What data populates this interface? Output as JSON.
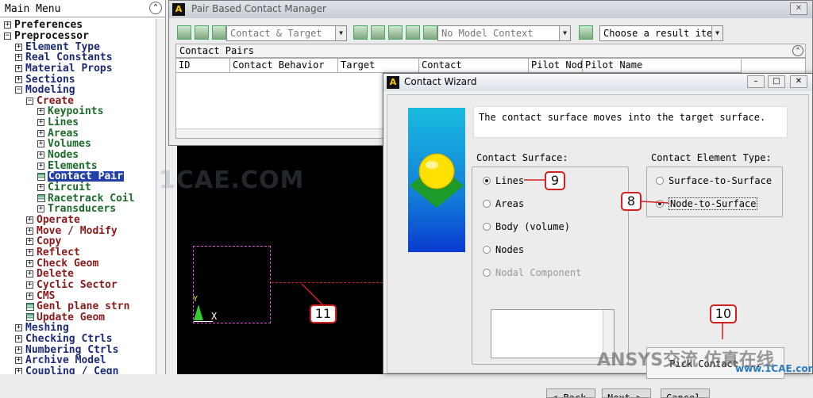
{
  "main_menu": {
    "title": "Main Menu",
    "items": [
      {
        "label": "Preferences",
        "exp": "box-plus",
        "indent": 0,
        "color": "black"
      },
      {
        "label": "Preprocessor",
        "exp": "box-minus",
        "indent": 0,
        "color": "black"
      },
      {
        "label": "Element Type",
        "exp": "box-plus",
        "indent": 1,
        "color": "blue"
      },
      {
        "label": "Real Constants",
        "exp": "box-plus",
        "indent": 1,
        "color": "blue"
      },
      {
        "label": "Material Props",
        "exp": "box-plus",
        "indent": 1,
        "color": "blue"
      },
      {
        "label": "Sections",
        "exp": "box-plus",
        "indent": 1,
        "color": "blue"
      },
      {
        "label": "Modeling",
        "exp": "box-minus",
        "indent": 1,
        "color": "blue"
      },
      {
        "label": "Create",
        "exp": "box-minus",
        "indent": 2,
        "color": "red"
      },
      {
        "label": "Keypoints",
        "exp": "box-plus",
        "indent": 3,
        "color": "green"
      },
      {
        "label": "Lines",
        "exp": "box-plus",
        "indent": 3,
        "color": "green"
      },
      {
        "label": "Areas",
        "exp": "box-plus",
        "indent": 3,
        "color": "green"
      },
      {
        "label": "Volumes",
        "exp": "box-plus",
        "indent": 3,
        "color": "green"
      },
      {
        "label": "Nodes",
        "exp": "box-plus",
        "indent": 3,
        "color": "green"
      },
      {
        "label": "Elements",
        "exp": "box-plus",
        "indent": 3,
        "color": "green"
      },
      {
        "label": "Contact Pair",
        "exp": "icon",
        "indent": 3,
        "color": "green",
        "selected": true
      },
      {
        "label": "Circuit",
        "exp": "box-plus",
        "indent": 3,
        "color": "green"
      },
      {
        "label": "Racetrack Coil",
        "exp": "icon",
        "indent": 3,
        "color": "green"
      },
      {
        "label": "Transducers",
        "exp": "box-plus",
        "indent": 3,
        "color": "green"
      },
      {
        "label": "Operate",
        "exp": "box-plus",
        "indent": 2,
        "color": "red"
      },
      {
        "label": "Move / Modify",
        "exp": "box-plus",
        "indent": 2,
        "color": "red"
      },
      {
        "label": "Copy",
        "exp": "box-plus",
        "indent": 2,
        "color": "red"
      },
      {
        "label": "Reflect",
        "exp": "box-plus",
        "indent": 2,
        "color": "red"
      },
      {
        "label": "Check Geom",
        "exp": "box-plus",
        "indent": 2,
        "color": "red"
      },
      {
        "label": "Delete",
        "exp": "box-plus",
        "indent": 2,
        "color": "red"
      },
      {
        "label": "Cyclic Sector",
        "exp": "box-plus",
        "indent": 2,
        "color": "red"
      },
      {
        "label": "CMS",
        "exp": "box-plus",
        "indent": 2,
        "color": "red"
      },
      {
        "label": "Genl plane strn",
        "exp": "icon",
        "indent": 2,
        "color": "red"
      },
      {
        "label": "Update Geom",
        "exp": "icon",
        "indent": 2,
        "color": "red"
      },
      {
        "label": "Meshing",
        "exp": "box-plus",
        "indent": 1,
        "color": "blue"
      },
      {
        "label": "Checking Ctrls",
        "exp": "box-plus",
        "indent": 1,
        "color": "blue"
      },
      {
        "label": "Numbering Ctrls",
        "exp": "box-plus",
        "indent": 1,
        "color": "blue"
      },
      {
        "label": "Archive Model",
        "exp": "box-plus",
        "indent": 1,
        "color": "blue"
      },
      {
        "label": "Coupling / Ceqn",
        "exp": "box-plus",
        "indent": 1,
        "color": "blue"
      }
    ]
  },
  "pbcm": {
    "title": "Pair Based Contact Manager",
    "toolbar": {
      "contact_target_select": "Contact & Target",
      "model_context_select": "No Model Context",
      "result_item_select": "Choose a result item"
    },
    "pairs_header": "Contact Pairs",
    "columns": [
      "ID",
      "Contact Behavior",
      "Target",
      "Contact",
      "Pilot Node",
      "Pilot Name"
    ]
  },
  "graphics": {
    "watermark": "1CAE.COM",
    "axis_x_label": "X",
    "axis_y_label": "Y"
  },
  "wizard": {
    "title": "Contact Wizard",
    "message": "The contact surface moves into the target surface.",
    "contact_surface_label": "Contact Surface:",
    "contact_surface_options": [
      {
        "label": "Lines",
        "checked": true,
        "disabled": false
      },
      {
        "label": "Areas",
        "checked": false,
        "disabled": false
      },
      {
        "label": "Body (volume)",
        "checked": false,
        "disabled": false
      },
      {
        "label": "Nodes",
        "checked": false,
        "disabled": false
      },
      {
        "label": "Nodal Component",
        "checked": false,
        "disabled": true
      }
    ],
    "element_type_label": "Contact Element Type:",
    "element_type_options": [
      {
        "label": "Surface-to-Surface",
        "checked": false
      },
      {
        "label": "Node-to-Surface",
        "checked": true
      }
    ],
    "pick_button": "Pick Contact ...",
    "back_button": "< Back",
    "next_button": "Next >",
    "cancel_button": "Cancel"
  },
  "callouts": {
    "c8": "8",
    "c9": "9",
    "c10": "10",
    "c11": "11"
  },
  "branding": {
    "text": "ANSYS交流 仿真在线",
    "site": "www.1CAE.com"
  },
  "colors": {
    "selection": "#2340a8",
    "callout_border": "#d42020",
    "tree_blue": "#1c2a7a",
    "tree_red": "#8b1a1a",
    "tree_green": "#1b6b2a"
  }
}
